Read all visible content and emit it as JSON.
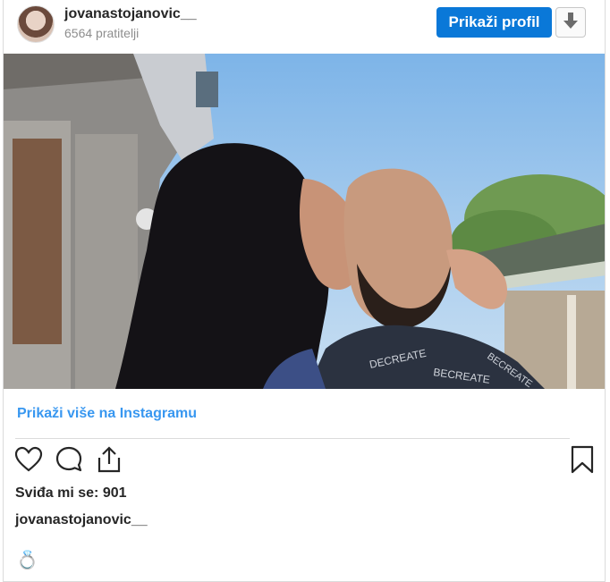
{
  "post": {
    "username": "jovanastojanovic__",
    "followers": "6564 pratitelji",
    "view_profile_label": "Prikaži profil",
    "more_on_instagram": "Prikaži više na Instagramu",
    "likes": "Sviđa mi se: 901",
    "caption_user": "jovanastojanovic__",
    "caption_emoji": "💍"
  },
  "icons": {
    "download": "download-arrow-icon",
    "like": "heart-icon",
    "comment": "comment-bubble-icon",
    "share": "share-icon",
    "save": "bookmark-icon"
  },
  "colors": {
    "button_blue": "#0a78d8",
    "link_blue": "#3897f0"
  }
}
